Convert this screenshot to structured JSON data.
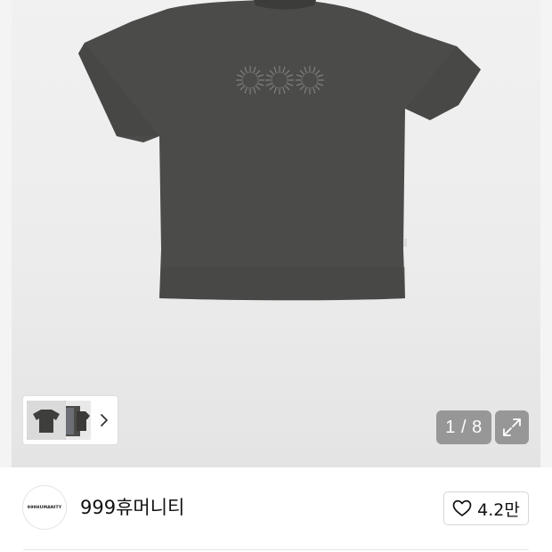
{
  "gallery": {
    "counter": "1 / 8",
    "current_index": 1,
    "total": 8,
    "colors": {
      "background": "#ececec",
      "shirt": "#4b4b49",
      "overlay": "#787878"
    }
  },
  "thumbnails": {
    "next_icon": "chevron-right-icon"
  },
  "expand": {
    "icon": "expand-icon"
  },
  "brand": {
    "name": "999휴머니티",
    "logo_text": "999HUMANITY"
  },
  "like": {
    "icon": "heart-icon",
    "count": "4.2만"
  }
}
